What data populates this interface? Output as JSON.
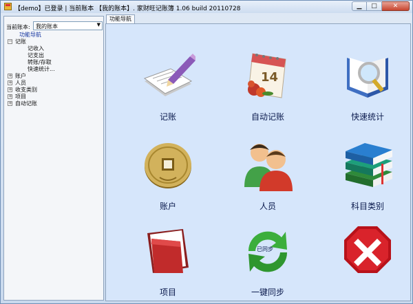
{
  "window": {
    "title": "【demo】已登录 | 当前账本 【我的账本】. 家财旺记账簿 1.06 build 20110728"
  },
  "left": {
    "account_label": "当前账本:",
    "account_value": "我的账本",
    "tree": {
      "nav": "功能导航",
      "ledger": "记账",
      "ledger_children": [
        "记收入",
        "记支出",
        "转账/存取",
        "快速统计..."
      ],
      "others": [
        "账户",
        "人员",
        "收支类别",
        "项目",
        "自动记账"
      ]
    }
  },
  "tab": {
    "label": "功能导航"
  },
  "tiles": [
    {
      "label": "记账",
      "icon": "pencil-paper-icon"
    },
    {
      "label": "自动记账",
      "icon": "calendar-icon",
      "calendar_day": "14"
    },
    {
      "label": "快速统计",
      "icon": "magnifier-book-icon"
    },
    {
      "label": "账户",
      "icon": "coin-icon"
    },
    {
      "label": "人员",
      "icon": "people-icon"
    },
    {
      "label": "科目类别",
      "icon": "books-icon"
    },
    {
      "label": "项目",
      "icon": "folder-icon"
    },
    {
      "label": "一键同步",
      "icon": "sync-arrows-icon",
      "badge": "已同步"
    },
    {
      "label": "",
      "icon": "exit-stop-icon"
    }
  ],
  "colors": {
    "content_bg": "#d6e6fb",
    "caption": "#0b1a4d"
  }
}
